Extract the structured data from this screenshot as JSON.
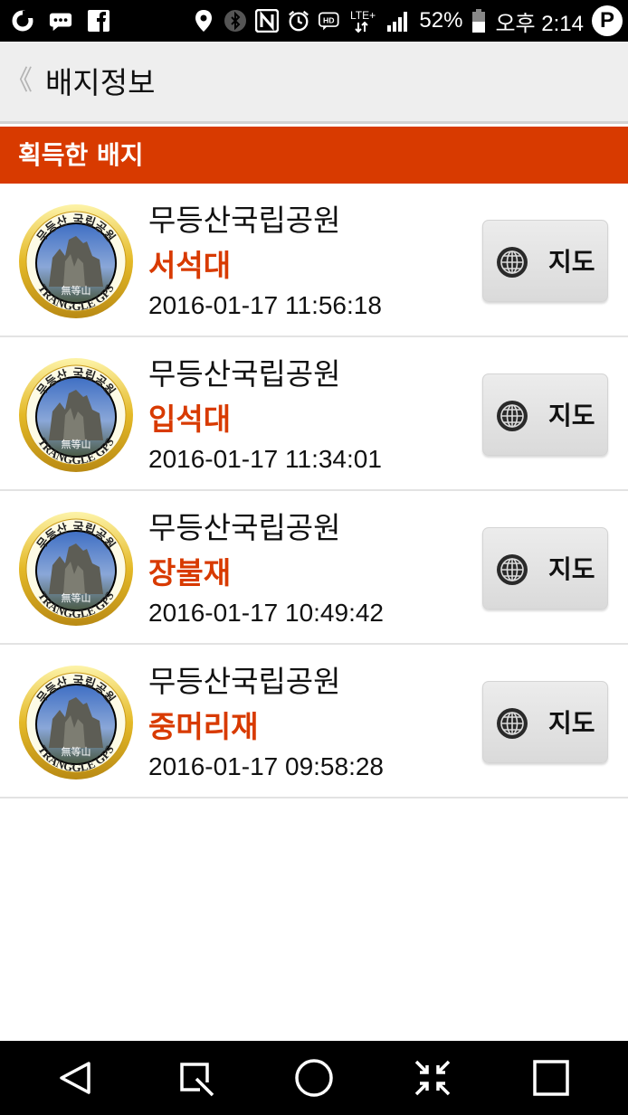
{
  "status_bar": {
    "icons": [
      "o-app-icon",
      "message-icon",
      "facebook-icon",
      "location-icon",
      "bluetooth-icon",
      "nfc-icon",
      "alarm-icon",
      "hd-icon",
      "lte-icon",
      "signal-icon",
      "battery-icon",
      "p-app-icon"
    ],
    "lte": "LTE+",
    "hd": "HD",
    "battery": "52%",
    "time": "오후 2:14",
    "p_label": "P"
  },
  "app_bar": {
    "back_glyph": "《",
    "title": "배지정보"
  },
  "section": {
    "title": "획득한 배지",
    "color": "#d83a00"
  },
  "badge_text": {
    "top": "무등산 국립공원",
    "bottom": "TRANGGLE GPS",
    "center": "無等山"
  },
  "badges": [
    {
      "park": "무등산국립공원",
      "peak": "서석대",
      "date": "2016-01-17 11:56:18",
      "map_label": "지도"
    },
    {
      "park": "무등산국립공원",
      "peak": "입석대",
      "date": "2016-01-17 11:34:01",
      "map_label": "지도"
    },
    {
      "park": "무등산국립공원",
      "peak": "장불재",
      "date": "2016-01-17 10:49:42",
      "map_label": "지도"
    },
    {
      "park": "무등산국립공원",
      "peak": "중머리재",
      "date": "2016-01-17 09:58:28",
      "map_label": "지도"
    }
  ],
  "nav_bar": {
    "buttons": [
      "back-icon",
      "capture-icon",
      "home-icon",
      "dual-window-icon",
      "recents-icon"
    ]
  }
}
